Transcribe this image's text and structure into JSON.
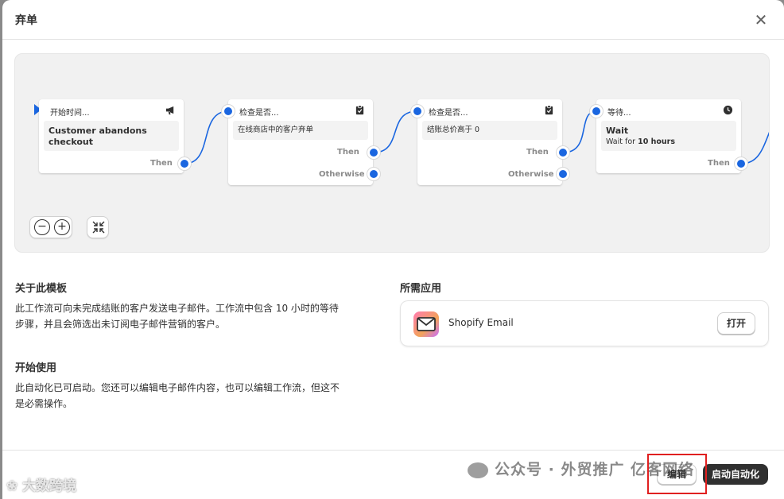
{
  "modal": {
    "title": "弃单"
  },
  "workflow": {
    "cards": [
      {
        "head": "开始时间...",
        "body_title": "Customer abandons checkout",
        "out_label": "Then"
      },
      {
        "head": "检查是否...",
        "body": "在线商店中的客户弃单",
        "then_label": "Then",
        "otherwise_label": "Otherwise"
      },
      {
        "head": "检查是否...",
        "body": "结账总价高于 0",
        "then_label": "Then",
        "otherwise_label": "Otherwise"
      },
      {
        "head": "等待...",
        "body_title": "Wait",
        "body_prefix": "Wait for ",
        "body_value": "10 hours",
        "out_label": "Then"
      }
    ]
  },
  "about": {
    "title": "关于此模板",
    "line1": "此工作流可向未完成结账的客户发送电子邮件。工作流中包含 10 小时的等待",
    "line2": "步骤，并且会筛选出未订阅电子邮件营销的客户。"
  },
  "start": {
    "title": "开始使用",
    "line1": "此自动化已可启动。您还可以编辑电子邮件内容，也可以编辑工作流，但这不",
    "line2": "是必需操作。"
  },
  "required_apps": {
    "title": "所需应用",
    "app_name": "Shopify Email",
    "open_label": "打开"
  },
  "footer": {
    "edit_label": "编辑",
    "launch_label": "启动自动化"
  },
  "watermarks": {
    "wechat": "公众号 · 外贸推广 亿客网络",
    "brand": "大数跨境"
  },
  "colors": {
    "accent": "#1a66e0",
    "dark_button": "#303030",
    "highlight": "#e02020"
  }
}
